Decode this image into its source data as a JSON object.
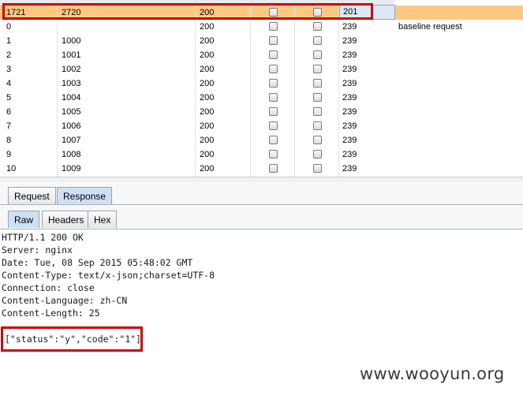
{
  "results": {
    "rows": [
      {
        "request": "1721",
        "payload": "2720",
        "status": "200",
        "length": "201",
        "comment": "",
        "selected": true
      },
      {
        "request": "0",
        "payload": "",
        "status": "200",
        "length": "239",
        "comment": "baseline request"
      },
      {
        "request": "1",
        "payload": "1000",
        "status": "200",
        "length": "239",
        "comment": ""
      },
      {
        "request": "2",
        "payload": "1001",
        "status": "200",
        "length": "239",
        "comment": ""
      },
      {
        "request": "3",
        "payload": "1002",
        "status": "200",
        "length": "239",
        "comment": ""
      },
      {
        "request": "4",
        "payload": "1003",
        "status": "200",
        "length": "239",
        "comment": ""
      },
      {
        "request": "5",
        "payload": "1004",
        "status": "200",
        "length": "239",
        "comment": ""
      },
      {
        "request": "6",
        "payload": "1005",
        "status": "200",
        "length": "239",
        "comment": ""
      },
      {
        "request": "7",
        "payload": "1006",
        "status": "200",
        "length": "239",
        "comment": ""
      },
      {
        "request": "8",
        "payload": "1007",
        "status": "200",
        "length": "239",
        "comment": ""
      },
      {
        "request": "9",
        "payload": "1008",
        "status": "200",
        "length": "239",
        "comment": ""
      },
      {
        "request": "10",
        "payload": "1009",
        "status": "200",
        "length": "239",
        "comment": ""
      }
    ]
  },
  "tabs_top": [
    {
      "label": "Request",
      "active": false
    },
    {
      "label": "Response",
      "active": true
    }
  ],
  "tabs_view": [
    {
      "label": "Raw",
      "active": true
    },
    {
      "label": "Headers",
      "active": false
    },
    {
      "label": "Hex",
      "active": false
    }
  ],
  "response": {
    "lines": [
      "HTTP/1.1 200 OK",
      "Server: nginx",
      "Date: Tue, 08 Sep 2015 05:48:02 GMT",
      "Content-Type: text/x-json;charset=UTF-8",
      "Connection: close",
      "Content-Language: zh-CN",
      "Content-Length: 25"
    ],
    "body": "[\"status\":\"y\",\"code\":\"1\"]"
  },
  "watermark": "www.wooyun.org",
  "colors": {
    "selected_row": "#ffc882",
    "highlight_border": "#d00000",
    "active_tab": "#cfe0f4"
  }
}
